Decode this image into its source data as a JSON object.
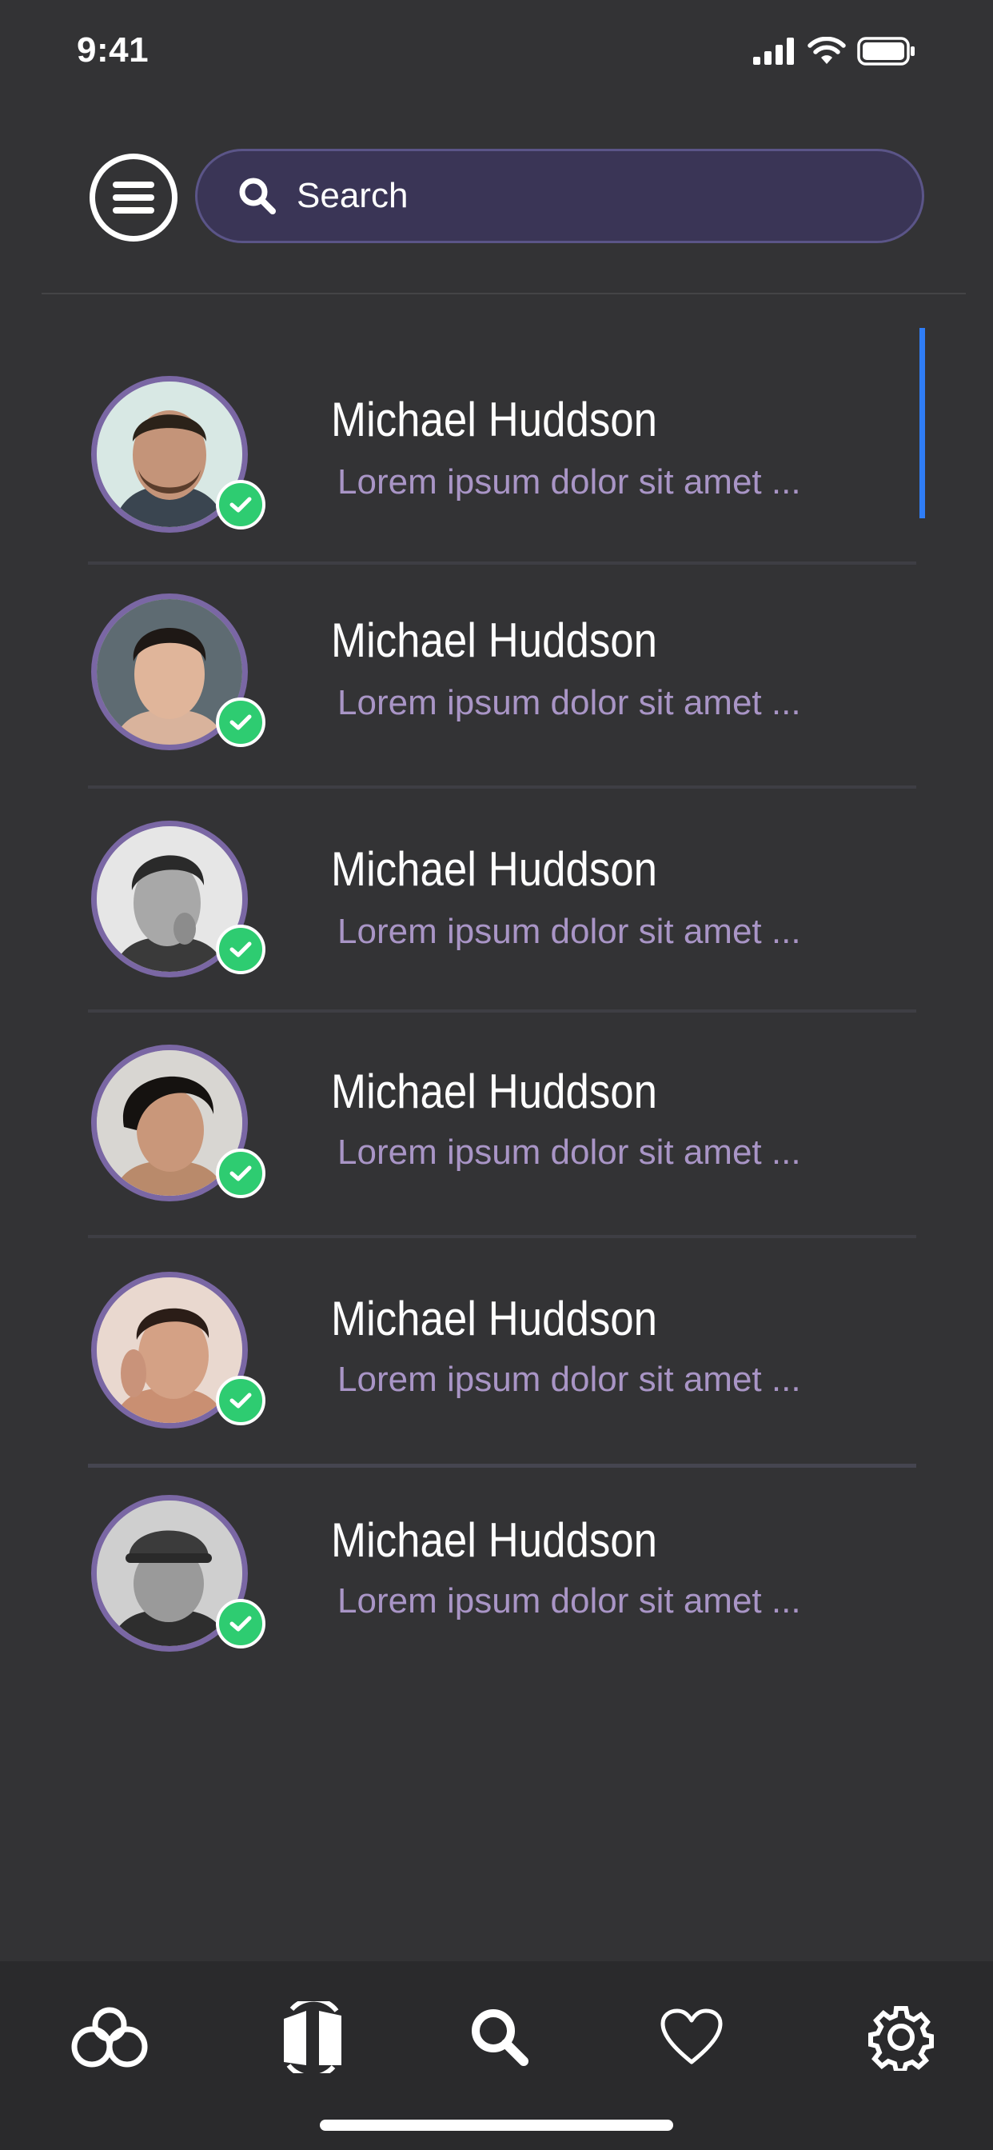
{
  "status_bar": {
    "time": "9:41"
  },
  "search": {
    "placeholder": "Search"
  },
  "contacts": [
    {
      "name": "Michael Huddson",
      "message": "Lorem ipsum dolor sit amet ..."
    },
    {
      "name": "Michael Huddson",
      "message": "Lorem ipsum dolor sit amet ..."
    },
    {
      "name": "Michael Huddson",
      "message": "Lorem ipsum dolor sit amet ..."
    },
    {
      "name": "Michael Huddson",
      "message": "Lorem ipsum dolor sit amet ..."
    },
    {
      "name": "Michael Huddson",
      "message": "Lorem ipsum dolor sit amet ..."
    },
    {
      "name": "Michael Huddson",
      "message": "Lorem ipsum dolor sit amet ..."
    }
  ],
  "tabs": [
    "connections-icon",
    "exchange-icon",
    "search-icon",
    "heart-icon",
    "settings-icon"
  ],
  "colors": {
    "background": "#333335",
    "search_bg": "#3a3556",
    "avatar_ring": "#7a67a4",
    "online_badge": "#2ecc71",
    "message_text": "#a995c6",
    "scroll_accent": "#2f7df6"
  }
}
